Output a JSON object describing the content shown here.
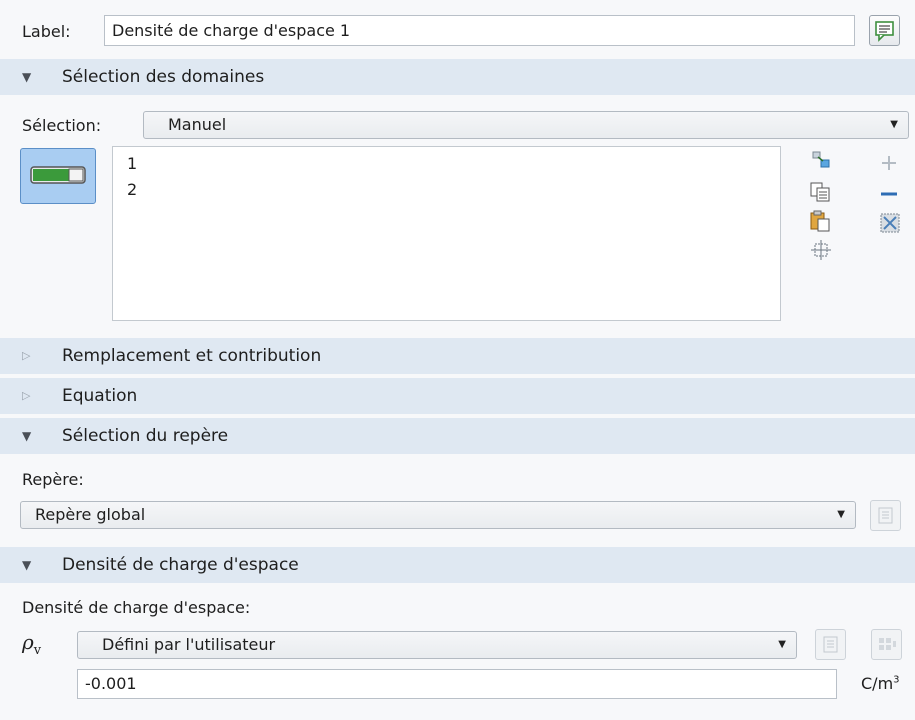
{
  "label_row": {
    "label": "Label:",
    "value": "Densité de charge d'espace 1",
    "icon": "comment-icon"
  },
  "sections": {
    "domain_selection": {
      "title": "Sélection des domaines",
      "expanded": true
    },
    "override": {
      "title": "Remplacement et contribution",
      "expanded": false
    },
    "equation": {
      "title": "Equation",
      "expanded": false
    },
    "frame_selection": {
      "title": "Sélection du repère",
      "expanded": true
    },
    "space_charge": {
      "title": "Densité de charge d'espace",
      "expanded": true
    }
  },
  "selection": {
    "label": "Sélection:",
    "value": "Manuel",
    "domains": [
      "1",
      "2"
    ],
    "active_toggle_icon": "active-toggle-icon"
  },
  "list_tools": [
    "zoom-to-selection-icon",
    "copy-icon",
    "paste-icon",
    "select-box-icon"
  ],
  "list_edit_tools": [
    "add-icon",
    "remove-icon",
    "clear-selection-icon"
  ],
  "frame": {
    "label": "Repère:",
    "value": "Repère global"
  },
  "charge": {
    "label": "Densité de charge d'espace:",
    "symbol": "ρ",
    "symbol_sub": "v",
    "value": "Défini par l'utilisateur",
    "input": "-0.001",
    "unit": "C/m",
    "unit_exp": "3"
  },
  "colors": {
    "section_bg": "#dfe8f2",
    "panel_bg": "#f7f8fa",
    "toggle_bg": "#a9cdf2",
    "toggle_green": "#3b9a3b"
  }
}
